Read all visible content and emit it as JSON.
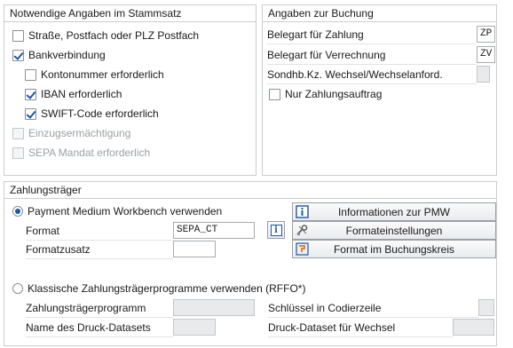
{
  "left_panel": {
    "title": "Notwendige Angaben im Stammsatz",
    "items": [
      {
        "label": "Straße, Postfach oder PLZ Postfach",
        "checked": false,
        "disabled": false
      },
      {
        "label": "Bankverbindung",
        "checked": true,
        "disabled": false
      },
      {
        "label": "Kontonummer erforderlich",
        "checked": false,
        "disabled": false
      },
      {
        "label": "IBAN erforderlich",
        "checked": true,
        "disabled": false
      },
      {
        "label": "SWIFT-Code erforderlich",
        "checked": true,
        "disabled": false
      },
      {
        "label": "Einzugsermächtigung",
        "checked": false,
        "disabled": true
      },
      {
        "label": "SEPA Mandat erforderlich",
        "checked": false,
        "disabled": true
      }
    ]
  },
  "right_panel": {
    "title": "Angaben zur Buchung",
    "fields": [
      {
        "label": "Belegart für Zahlung",
        "value": "ZP"
      },
      {
        "label": "Belegart für Verrechnung",
        "value": "ZV"
      },
      {
        "label": "Sondhb.Kz. Wechsel/Wechselanford.",
        "value": ""
      }
    ],
    "checkbox": {
      "label": "Nur Zahlungsauftrag",
      "checked": false
    }
  },
  "payment_panel": {
    "title": "Zahlungsträger",
    "pmw_radio": {
      "label": "Payment Medium Workbench verwenden",
      "selected": true
    },
    "format": {
      "label": "Format",
      "value": "SEPA_CT"
    },
    "format_suffix": {
      "label": "Formatzusatz",
      "value": ""
    },
    "buttons": {
      "info": "Informationen zur PMW",
      "settings": "Formateinstellungen",
      "company_code": "Format im Buchungskreis"
    },
    "classic_radio": {
      "label": "Klassische Zahlungsträgerprogramme verwenden (RFFO*)",
      "selected": false
    },
    "classic_fields": {
      "program": {
        "label": "Zahlungsträgerprogramm",
        "value": ""
      },
      "print_dataset": {
        "label": "Name des Druck-Datasets",
        "value": ""
      },
      "code_key": {
        "label": "Schlüssel in Codierzeile",
        "value": ""
      },
      "bill_dataset": {
        "label": "Druck-Dataset für Wechsel",
        "value": ""
      }
    }
  },
  "colors": {
    "accent": "#1b57a5",
    "border": "#c9cdd2",
    "disabled_text": "#9ba0a6"
  }
}
